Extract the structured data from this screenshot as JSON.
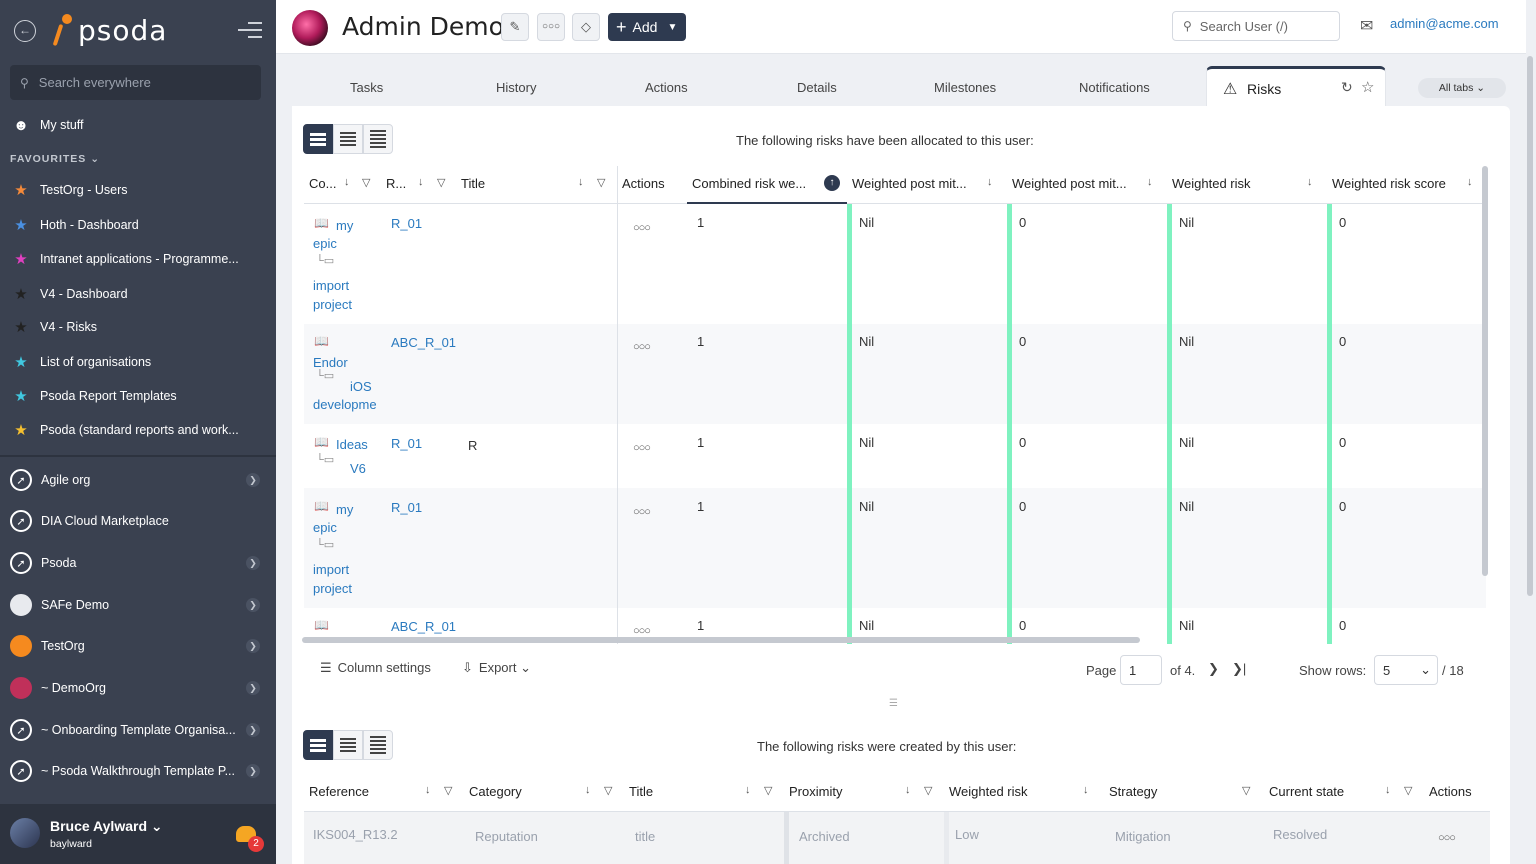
{
  "sidebar": {
    "logo": "psoda",
    "search_placeholder": "Search everywhere",
    "my_stuff": "My stuff",
    "favourites_heading": "FAVOURITES",
    "favourites": [
      {
        "label": "TestOrg - Users",
        "color": "#f58a3a"
      },
      {
        "label": "Hoth - Dashboard",
        "color": "#4a90e2"
      },
      {
        "label": "Intranet applications - Programme...",
        "color": "#e040c0"
      },
      {
        "label": "V4 - Dashboard",
        "color": "#222222"
      },
      {
        "label": "V4 - Risks",
        "color": "#222222"
      },
      {
        "label": "List of organisations",
        "color": "#40c8e0"
      },
      {
        "label": "Psoda Report Templates",
        "color": "#40c8e0"
      },
      {
        "label": "Psoda (standard reports and work...",
        "color": "#f5c030"
      }
    ],
    "orgs": [
      {
        "label": "Agile org",
        "chevron": true
      },
      {
        "label": "DIA Cloud Marketplace",
        "chevron": false
      },
      {
        "label": "Psoda",
        "chevron": true
      },
      {
        "label": "SAFe Demo",
        "chevron": true
      },
      {
        "label": "TestOrg",
        "chevron": true
      },
      {
        "label": "~ DemoOrg",
        "chevron": true
      },
      {
        "label": "~ Onboarding Template Organisa...",
        "chevron": true
      },
      {
        "label": "~ Psoda Walkthrough Template P...",
        "chevron": true
      }
    ],
    "user_name": "Bruce Aylward",
    "user_handle": "baylward",
    "notifications": "2"
  },
  "header": {
    "title": "Admin Demo",
    "add_label": "Add",
    "search_placeholder": "Search User (/)",
    "email": "admin@acme.com"
  },
  "tabs": [
    "Tasks",
    "History",
    "Actions",
    "Details",
    "Milestones",
    "Notifications"
  ],
  "active_tab": "Risks",
  "all_tabs": "All tabs",
  "allocated": {
    "caption": "The following risks have been allocated to this user:",
    "columns": [
      "Co...",
      "R...",
      "Title",
      "Actions",
      "Combined risk we...",
      "Weighted post mit...",
      "Weighted post mit...",
      "Weighted risk",
      "Weighted risk score"
    ],
    "rows": [
      {
        "context": [
          "my",
          "epic",
          "import",
          "project"
        ],
        "ref": "R_01",
        "title": "",
        "combined": "1",
        "wpm1": "Nil",
        "wpm2": "0",
        "wr": "Nil",
        "wrs": "0"
      },
      {
        "context": [
          "Endor",
          "iOS",
          "developme"
        ],
        "ref": "ABC_R_01",
        "title": "",
        "combined": "1",
        "wpm1": "Nil",
        "wpm2": "0",
        "wr": "Nil",
        "wrs": "0"
      },
      {
        "context": [
          "Ideas",
          "V6"
        ],
        "ref": "R_01",
        "title": "R",
        "combined": "1",
        "wpm1": "Nil",
        "wpm2": "0",
        "wr": "Nil",
        "wrs": "0"
      },
      {
        "context": [
          "my",
          "epic",
          "import",
          "project"
        ],
        "ref": "R_01",
        "title": "",
        "combined": "1",
        "wpm1": "Nil",
        "wpm2": "0",
        "wr": "Nil",
        "wrs": "0"
      },
      {
        "context": [],
        "ref": "ABC_R_01",
        "title": "",
        "combined": "1",
        "wpm1": "Nil",
        "wpm2": "0",
        "wr": "Nil",
        "wrs": "0"
      }
    ],
    "column_settings": "Column settings",
    "export": "Export",
    "page_label": "Page",
    "page": "1",
    "of_pages": "of 4.",
    "show_rows_label": "Show rows:",
    "rows_per_page": "5",
    "total": "/ 18"
  },
  "created": {
    "caption": "The following risks were created by this user:",
    "columns": [
      "Reference",
      "Category",
      "Title",
      "Proximity",
      "Weighted risk",
      "Strategy",
      "Current state",
      "Actions"
    ],
    "row": {
      "reference": "IKS004_R13.2",
      "category": "Reputation",
      "title": "title",
      "proximity": "Archived",
      "weighted_risk": "Low",
      "strategy": "Mitigation",
      "state": "Resolved"
    }
  }
}
